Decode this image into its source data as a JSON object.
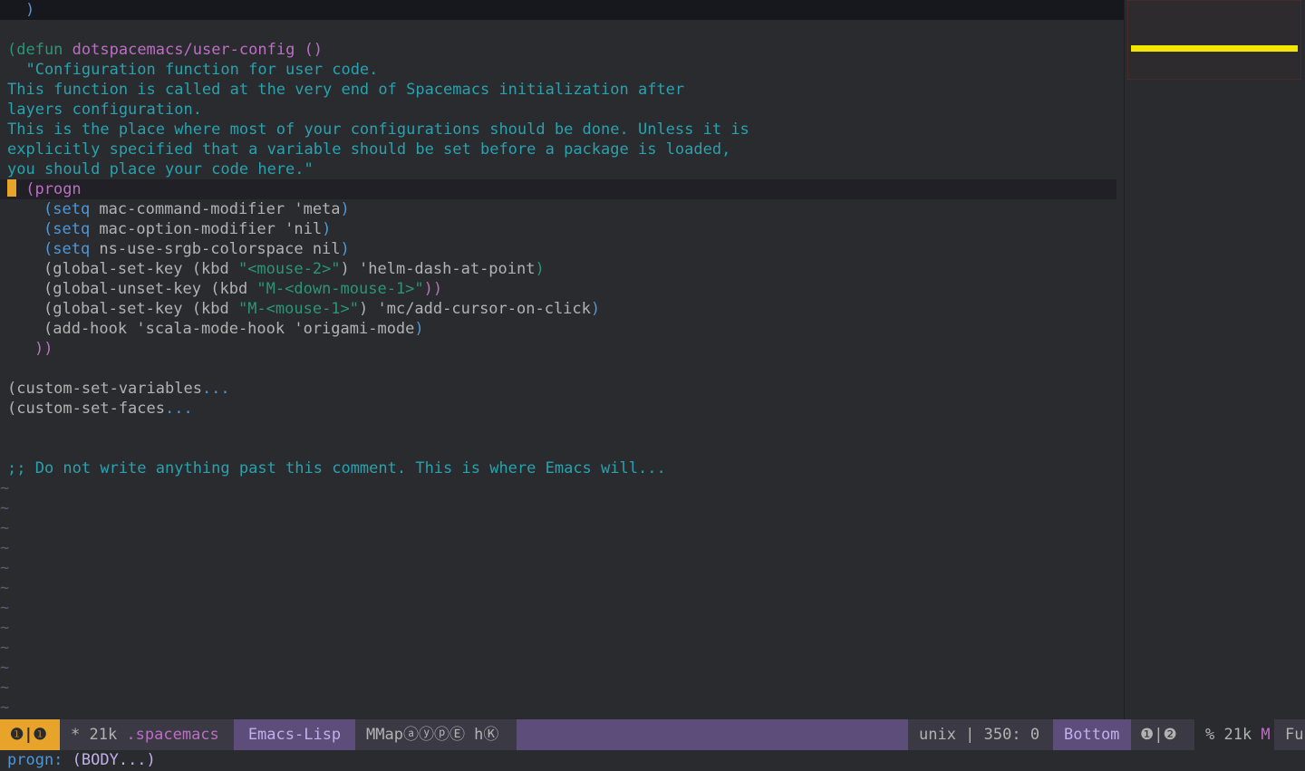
{
  "editor": {
    "top_line": ")",
    "defun": {
      "kw": "(defun",
      "name": "dotspacemacs/user-config",
      "args": "()"
    },
    "doc": [
      "  \"Configuration function for user code.",
      "This function is called at the very end of Spacemacs initialization after",
      "layers configuration.",
      "This is the place where most of your configurations should be done. Unless it is",
      "explicitly specified that a variable should be set before a package is loaded,",
      "you should place your code here.\""
    ],
    "progn": "(progn",
    "body": [
      {
        "head": "(setq",
        "rest": " mac-command-modifier 'meta",
        "close": ")"
      },
      {
        "head": "(setq",
        "rest": " mac-option-modifier 'nil",
        "close": ")"
      },
      {
        "head": "(setq",
        "rest": " ns-use-srgb-colorspace nil",
        "close": ")"
      },
      {
        "head": "(global-set-key",
        "rest": " (kbd ",
        "str": "\"<mouse-2>\"",
        "tail": ") 'helm-dash-at-point",
        "close": ")"
      },
      {
        "head": "(global-unset-key",
        "rest": " (kbd ",
        "str": "\"M-<down-mouse-1>\"",
        "tail": ")",
        "close": ")"
      },
      {
        "head": "(global-set-key",
        "rest": " (kbd ",
        "str": "\"M-<mouse-1>\"",
        "tail": ") 'mc/add-cursor-on-click",
        "close": ")"
      },
      {
        "head": "(add-hook",
        "rest": " 'scala-mode-hook 'origami-mode",
        "close": ")"
      }
    ],
    "progn_close": "))",
    "folded": [
      {
        "text": "(custom-set-variables",
        "ellipsis": "..."
      },
      {
        "text": "(custom-set-faces",
        "ellipsis": "..."
      }
    ],
    "comment": ";; Do not write anything past this comment. This is where Emacs will...",
    "tilde": "~"
  },
  "modeline": {
    "window": "❶|❶",
    "modified": "* 21k ",
    "buffer": ".spacemacs",
    "major_mode": "Emacs-Lisp",
    "minor_modes": "MMapⓐⓨⓟⒺ hⓀ",
    "encoding": "unix | 350: 0",
    "position": "Bottom",
    "window2": "❶|❷",
    "size": "% 21k ",
    "m": "M",
    "fu": "Fu"
  },
  "echo": {
    "label": "progn:",
    "args": " (BODY...)"
  }
}
